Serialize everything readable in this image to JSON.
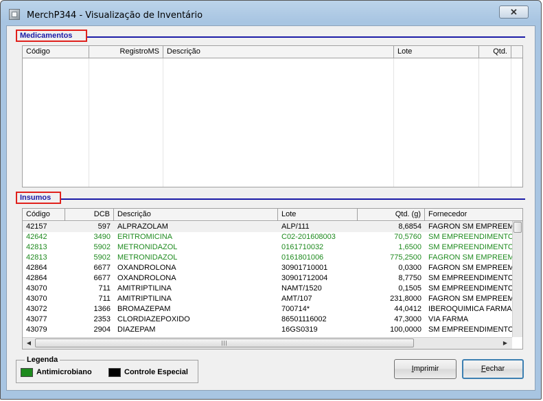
{
  "window": {
    "title": "MerchP344 - Visualização de Inventário",
    "close_glyph": "✕"
  },
  "medicamentos": {
    "label": "Medicamentos",
    "columns": [
      "Código",
      "RegistroMS",
      "Descrição",
      "Lote",
      "Qtd."
    ],
    "rows": []
  },
  "insumos": {
    "label": "Insumos",
    "columns": [
      "Código",
      "DCB",
      "Descrição",
      "Lote",
      "Qtd. (g)",
      "Fornecedor"
    ],
    "rows": [
      {
        "codigo": "42157",
        "dcb": "597",
        "descricao": "ALPRAZOLAM",
        "lote": "ALP/111",
        "qtd": "8,6854",
        "fornecedor": "FAGRON SM EMPREEMD",
        "type": "normal"
      },
      {
        "codigo": "42642",
        "dcb": "3490",
        "descricao": "ERITROMICINA",
        "lote": "C02-201608003",
        "qtd": "70,5760",
        "fornecedor": "SM EMPREENDIMENTOS",
        "type": "antimicrobiano"
      },
      {
        "codigo": "42813",
        "dcb": "5902",
        "descricao": "METRONIDAZOL",
        "lote": "0161710032",
        "qtd": "1,6500",
        "fornecedor": "SM EMPREENDIMENTOS",
        "type": "antimicrobiano"
      },
      {
        "codigo": "42813",
        "dcb": "5902",
        "descricao": "METRONIDAZOL",
        "lote": "0161801006",
        "qtd": "775,2500",
        "fornecedor": "FAGRON SM EMPREEMD",
        "type": "antimicrobiano"
      },
      {
        "codigo": "42864",
        "dcb": "6677",
        "descricao": "OXANDROLONA",
        "lote": "30901710001",
        "qtd": "0,0300",
        "fornecedor": "FAGRON SM EMPREEMD",
        "type": "normal"
      },
      {
        "codigo": "42864",
        "dcb": "6677",
        "descricao": "OXANDROLONA",
        "lote": "30901712004",
        "qtd": "8,7750",
        "fornecedor": "SM EMPREENDIMENTOS",
        "type": "normal"
      },
      {
        "codigo": "43070",
        "dcb": "711",
        "descricao": "AMITRIPTILINA",
        "lote": "NAMT/1520",
        "qtd": "0,1505",
        "fornecedor": "SM EMPREENDIMENTOS",
        "type": "normal"
      },
      {
        "codigo": "43070",
        "dcb": "711",
        "descricao": "AMITRIPTILINA",
        "lote": "AMT/107",
        "qtd": "231,8000",
        "fornecedor": "FAGRON SM EMPREEMD",
        "type": "normal"
      },
      {
        "codigo": "43072",
        "dcb": "1366",
        "descricao": "BROMAZEPAM",
        "lote": "700714*",
        "qtd": "44,0412",
        "fornecedor": "IBEROQUIMICA FARMAC",
        "type": "normal"
      },
      {
        "codigo": "43077",
        "dcb": "2353",
        "descricao": "CLORDIAZEPOXIDO",
        "lote": "86501116002",
        "qtd": "47,3000",
        "fornecedor": "VIA FARMA",
        "type": "normal"
      },
      {
        "codigo": "43079",
        "dcb": "2904",
        "descricao": "DIAZEPAM",
        "lote": "16GS0319",
        "qtd": "100,0000",
        "fornecedor": "SM EMPREENDIMENTOS",
        "type": "normal"
      }
    ]
  },
  "legend": {
    "title": "Legenda",
    "antimicrobiano_label": "Antimicrobiano",
    "controle_label": "Controle Especial",
    "antimicrobiano_color": "#1e8a1e",
    "controle_color": "#000000"
  },
  "buttons": {
    "imprimir_first": "I",
    "imprimir_rest": "mprimir",
    "fechar_first": "F",
    "fechar_rest": "echar"
  },
  "colors": {
    "section_label": "#1a1aa6",
    "section_border": "#e0201b",
    "antimicrobiano_text": "#1e8a1e"
  },
  "icons": {
    "app": "app-icon",
    "close": "close-icon",
    "scroll_up": "arrow-up-icon",
    "scroll_down": "arrow-down-icon",
    "scroll_left": "arrow-left-icon",
    "scroll_right": "arrow-right-icon"
  }
}
